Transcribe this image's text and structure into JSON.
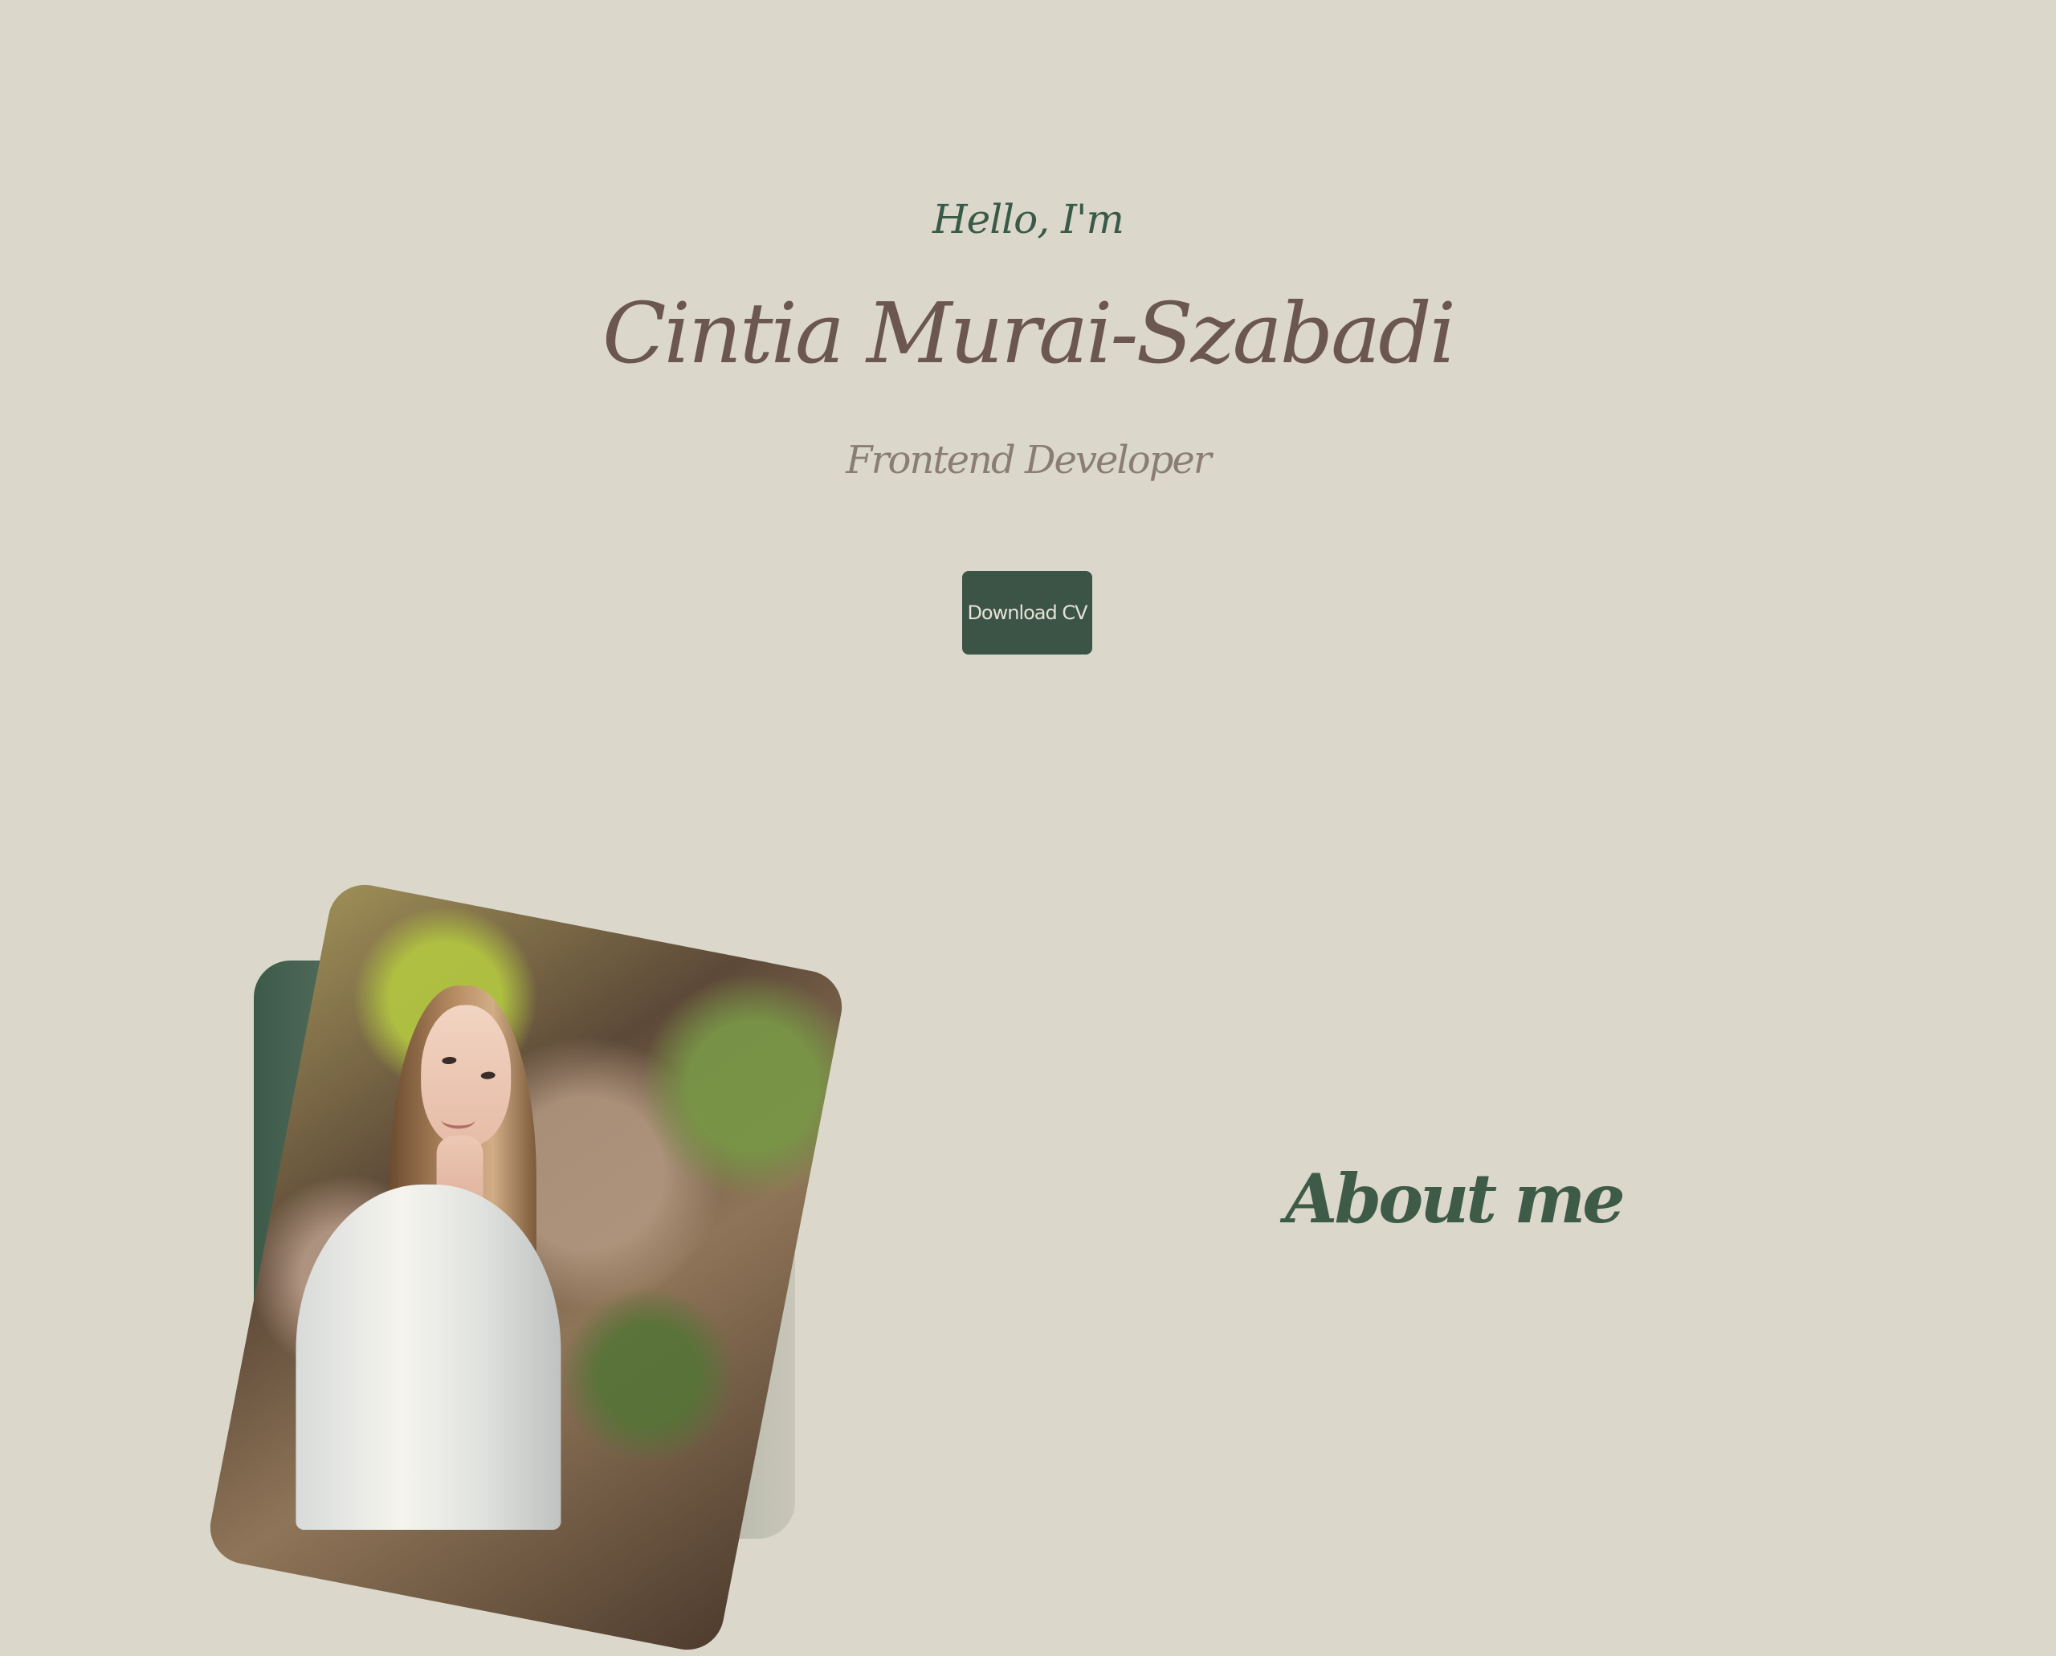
{
  "hero": {
    "greeting": "Hello, I'm",
    "name": "Cintia Murai-Szabadi",
    "role": "Frontend Developer",
    "cta_label": "Download CV"
  },
  "about": {
    "title": "About me"
  },
  "photo": {
    "alt": "Portrait of Cintia Murai-Szabadi"
  },
  "colors": {
    "background": "#dbd8cb",
    "accent": "#3c5446",
    "name": "#6b5650",
    "muted": "#8a7d75"
  }
}
